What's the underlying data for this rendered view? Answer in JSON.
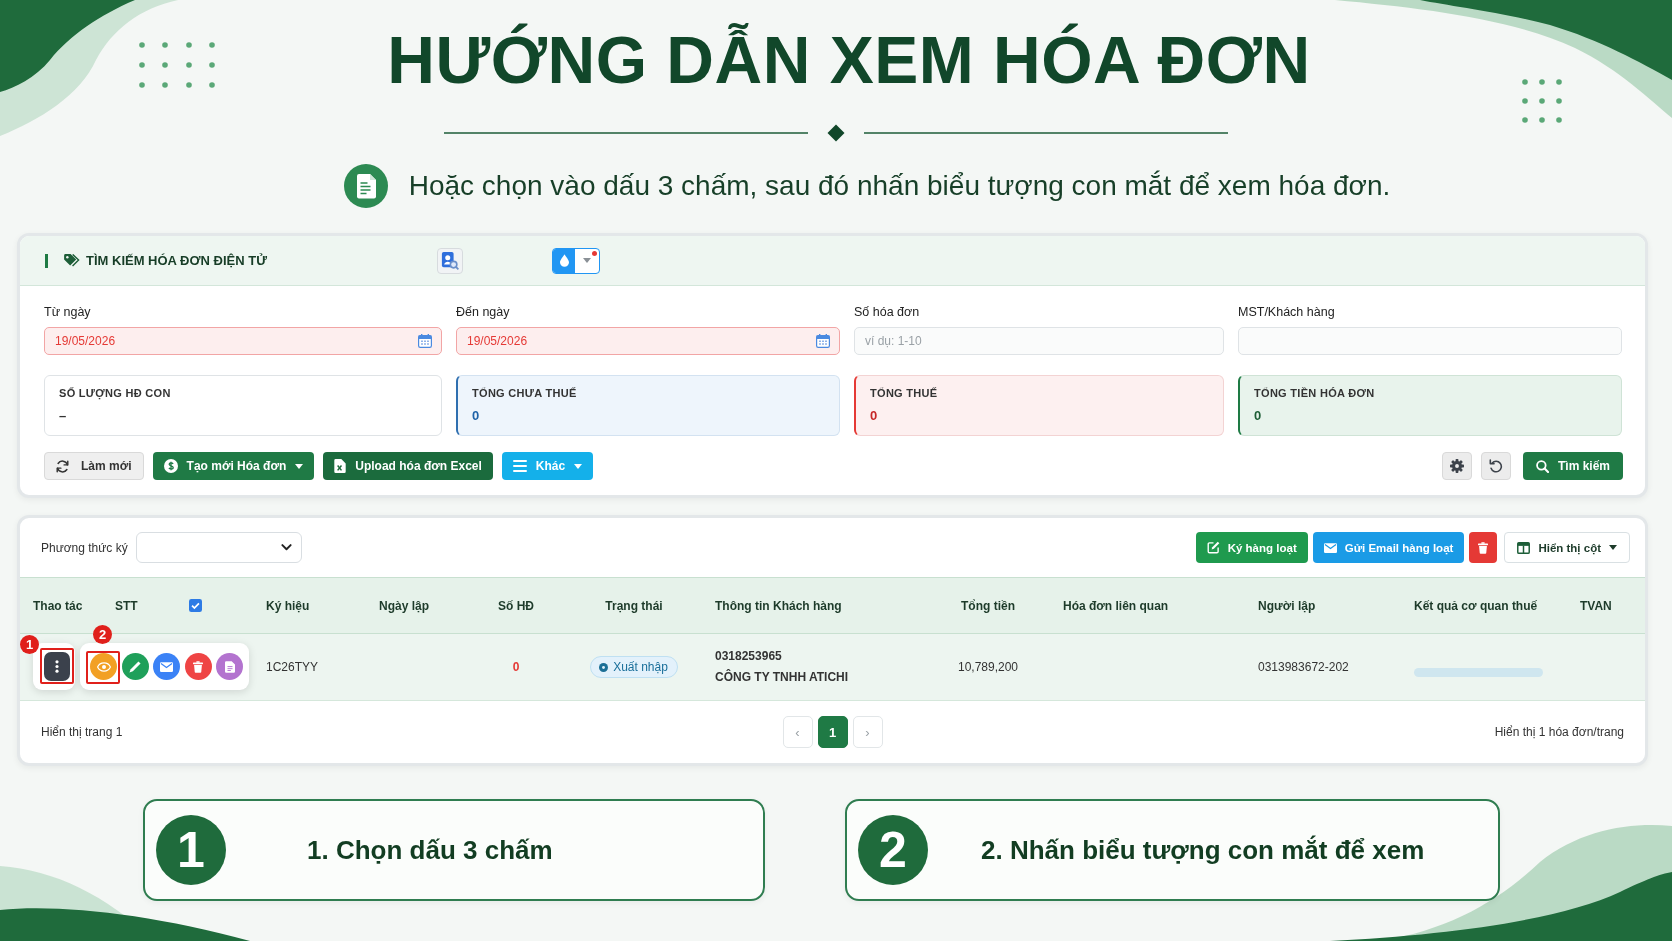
{
  "guide": {
    "title": "HƯỚNG DẪN XEM HÓA ĐƠN",
    "subtitle": "Hoặc chọn vào dấu 3 chấm, sau đó nhấn biểu tượng con mắt để xem hóa đơn."
  },
  "search_panel": {
    "title": "TÌM KIẾM HÓA ĐƠN ĐIỆN TỬ",
    "fields": [
      {
        "label": "Từ ngày",
        "kind": "date",
        "value": "19/05/2026",
        "invalid": true
      },
      {
        "label": "Đến ngày",
        "kind": "date",
        "value": "19/05/2026",
        "invalid": true
      },
      {
        "label": "Số hóa đơn",
        "kind": "text",
        "placeholder": "ví dụ: 1-10",
        "invalid": false
      },
      {
        "label": "MST/Khách hàng",
        "kind": "text",
        "invalid": false
      }
    ],
    "summaries": [
      {
        "label": "SỐ LƯỢNG HĐ CON",
        "value": "–",
        "kind": "neutral"
      },
      {
        "label": "TỔNG CHƯA THUẾ",
        "value": "0",
        "kind": "info"
      },
      {
        "label": "TỔNG THUẾ",
        "value": "0",
        "kind": "danger"
      },
      {
        "label": "TỔNG TIỀN HÓA ĐƠN",
        "value": "0",
        "kind": "success"
      }
    ],
    "actions": [
      {
        "label": "Làm mới",
        "kind": "refresh",
        "dropdown": false
      },
      {
        "label": "Tạo mới Hóa đơn",
        "kind": "create",
        "dropdown": true
      },
      {
        "label": "Upload hóa đơn Excel",
        "kind": "upload",
        "dropdown": false
      },
      {
        "label": "Khác",
        "kind": "more",
        "dropdown": true
      }
    ],
    "tools": [
      {
        "kind": "settings",
        "dropdown": false
      },
      {
        "kind": "reset",
        "dropdown": false
      },
      {
        "kind": "search",
        "label": "Tìm kiếm",
        "dropdown": false
      }
    ]
  },
  "invoice_panel": {
    "sign_method": {
      "label": "Phương thức ký"
    },
    "bulk_actions": [
      {
        "label": "Ký hàng loạt",
        "kind": "sign",
        "dropdown": false
      },
      {
        "label": "Gửi Email hàng loạt",
        "kind": "email",
        "dropdown": false
      },
      {
        "kind": "delete",
        "dropdown": false
      },
      {
        "label": "Hiển thị cột",
        "kind": "columns",
        "dropdown": true
      }
    ],
    "columns": [
      {
        "kind": "text",
        "label": "Thao tác"
      },
      {
        "kind": "text",
        "label": "STT"
      },
      {
        "kind": "checkbox",
        "checked": true
      },
      {
        "kind": "text",
        "label": "Ký hiệu"
      },
      {
        "kind": "text",
        "label": "Ngày lập"
      },
      {
        "kind": "text",
        "label": "Số HĐ"
      },
      {
        "kind": "text",
        "label": "Trạng thái"
      },
      {
        "kind": "text",
        "label": "Thông tin Khách hàng"
      },
      {
        "kind": "text",
        "label": "Tổng tiền"
      },
      {
        "kind": "text",
        "label": "Hóa đơn liên quan"
      },
      {
        "kind": "text",
        "label": "Người lập"
      },
      {
        "kind": "text",
        "label": "Kết quả cơ quan thuế"
      },
      {
        "kind": "text",
        "label": "TVAN"
      }
    ],
    "rows": [
      {
        "menu_button": {
          "highlighted": true,
          "marker": "1"
        },
        "row_actions": [
          {
            "kind": "view",
            "highlighted": true,
            "marker": "2"
          },
          {
            "kind": "edit",
            "highlighted": false
          },
          {
            "kind": "email",
            "highlighted": false
          },
          {
            "kind": "delete",
            "highlighted": false
          },
          {
            "kind": "document",
            "highlighted": false
          }
        ],
        "symbol": "1C26TYY",
        "invoice_number": "0",
        "status": "Xuất nhập",
        "customer_tax_code": "0318253965",
        "customer_name": "CÔNG TY TNHH ATICHI",
        "total": "10,789,200",
        "creator": "0313983672-202"
      }
    ],
    "footer": {
      "page_info": "Hiển thị trang 1",
      "previous": "‹",
      "pages": [
        {
          "label": "1",
          "selected": true
        }
      ],
      "next": "›",
      "per_page": "Hiển thị 1 hóa đơn/trang"
    }
  },
  "steps": [
    {
      "number": "1",
      "text": "1. Chọn dấu 3 chấm"
    },
    {
      "number": "2",
      "text": "2. Nhấn biểu tượng con mắt để xem"
    }
  ]
}
